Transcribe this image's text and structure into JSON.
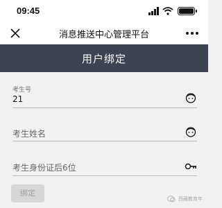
{
  "status_bar": {
    "time": "09:45",
    "icons": [
      "signal-icon",
      "wifi-icon",
      "battery-icon"
    ]
  },
  "nav": {
    "close_icon": "close-icon",
    "title": "消息推送中心管理平台",
    "more_icon": "more-icon"
  },
  "header": {
    "title": "用户绑定",
    "background": "#3d4350"
  },
  "form": {
    "exam_number": {
      "label": "考生号",
      "value": "21",
      "icon": "face-icon"
    },
    "exam_name": {
      "placeholder": "考生姓名",
      "icon": "face-icon"
    },
    "id_last_six": {
      "placeholder": "考生身份证后6位",
      "icon": "key-icon"
    },
    "bind_button": "绑定"
  },
  "watermark": {
    "text": "西藏教育年"
  },
  "colors": {
    "page_background": "#f2f2f2",
    "button_disabled": "#d7d7d7",
    "underline": "#bbbbbb"
  }
}
